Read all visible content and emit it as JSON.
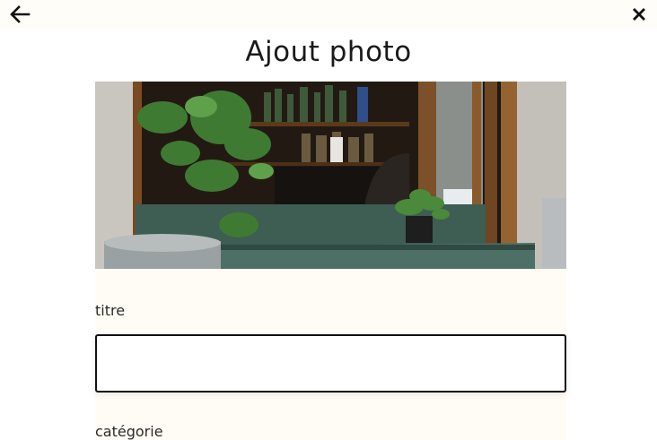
{
  "header": {
    "back_icon": "arrow-left-icon",
    "close_icon": "close-icon",
    "title": "Ajout photo"
  },
  "photo": {
    "description_icon": "photo-preview"
  },
  "form": {
    "titre_label": "titre",
    "titre_value": "",
    "categorie_label": "catégorie"
  }
}
